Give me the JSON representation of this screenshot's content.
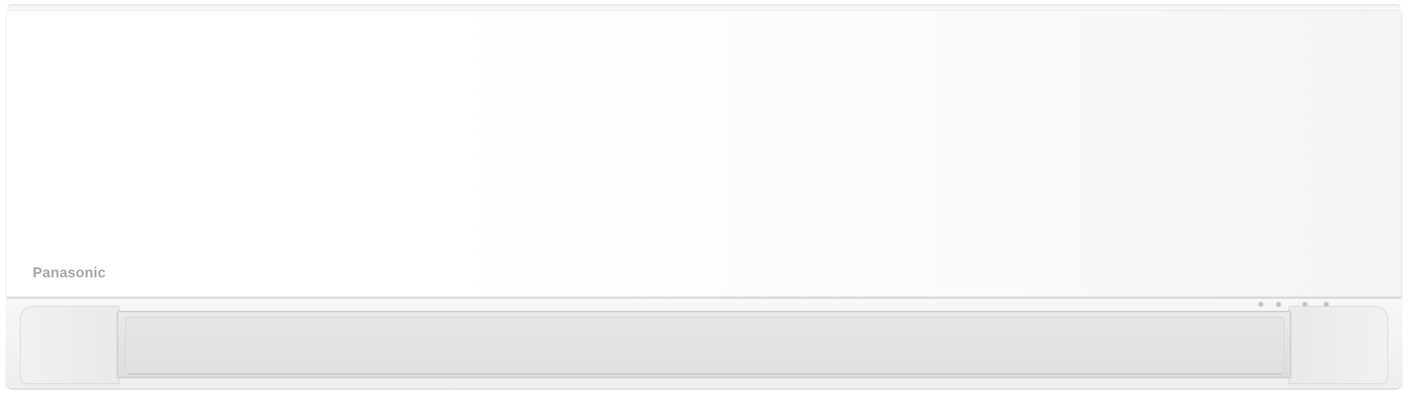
{
  "product": {
    "brand": "Panasonic"
  },
  "colors": {
    "body": "#ffffff",
    "logo": "#a6a6a6",
    "louver": "#e2e2e2"
  },
  "indicator_lamps": [
    "lamp",
    "lamp",
    "lamp",
    "lamp"
  ]
}
